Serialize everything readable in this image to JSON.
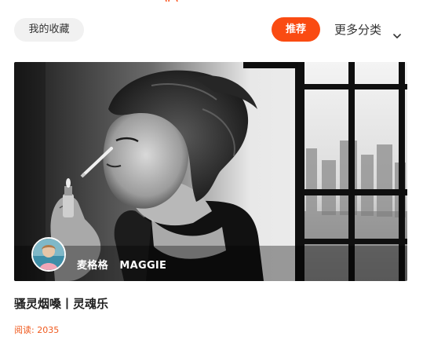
{
  "header": {
    "favorites_label": "我的收藏",
    "recommend_label": "推荐",
    "more_categories_label": "更多分类"
  },
  "icons": {
    "more_categories": "chevron-down-icon"
  },
  "article": {
    "author": "麦格格   MAGGIE",
    "title": "骚灵烟嗓丨灵魂乐",
    "read_label": "阅读: 2035"
  },
  "colors": {
    "accent": "#fa4b12",
    "read_count": "#f05a1e",
    "chip_background": "#f1f1f1"
  }
}
